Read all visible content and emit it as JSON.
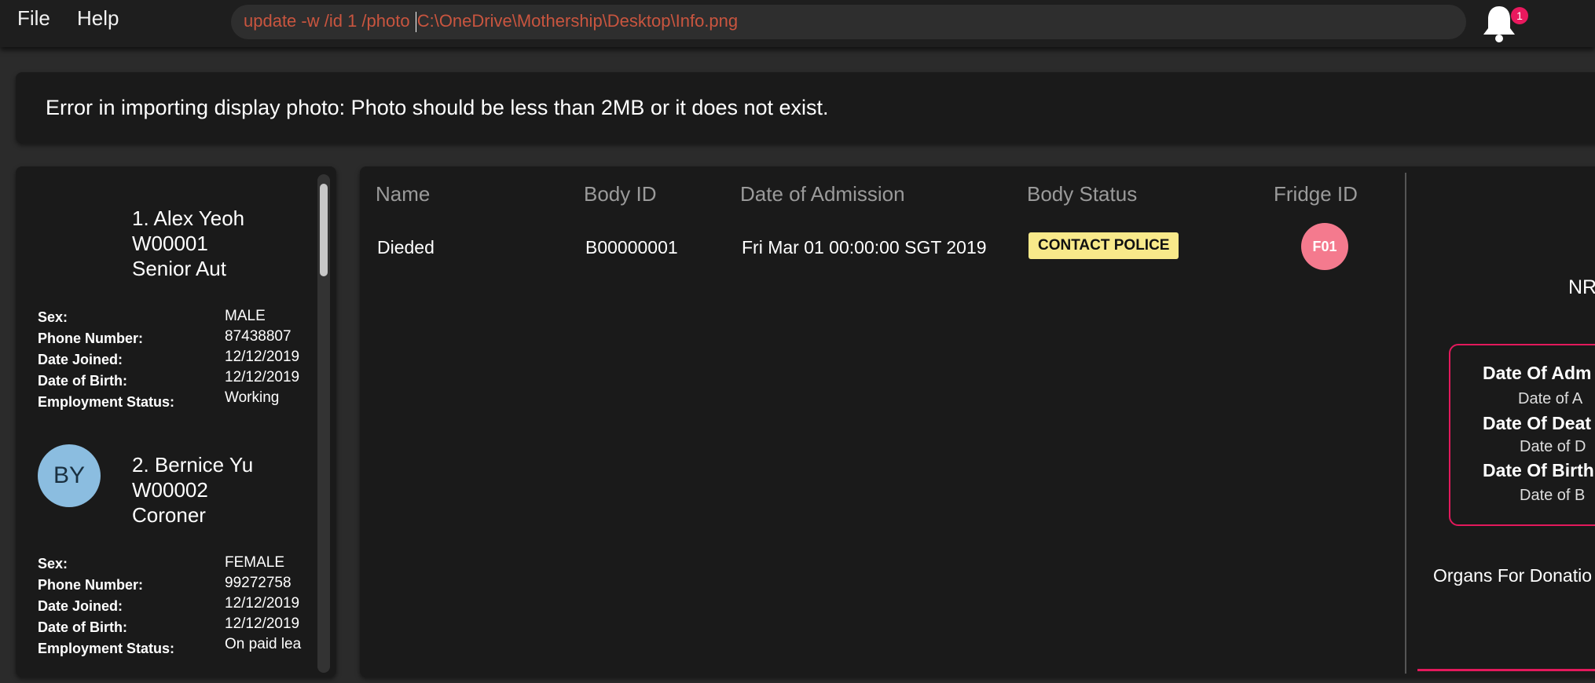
{
  "menu": {
    "file": "File",
    "help": "Help"
  },
  "command": {
    "before_cursor": "update -w /id 1 /photo ",
    "after_cursor": "C:\\OneDrive\\Mothership\\Desktop\\Info.png"
  },
  "notifications": {
    "count": "1"
  },
  "result": {
    "message": "Error in importing display photo: Photo should be less than 2MB or it does not exist."
  },
  "workers": [
    {
      "index_name": "1. Alex Yeoh",
      "id": "W00001",
      "designation": "Senior Aut",
      "initials": "",
      "sex_label": "Sex:",
      "sex": "MALE",
      "phone_label": "Phone Number:",
      "phone": "87438807",
      "joined_label": "Date Joined:",
      "joined": "12/12/2019",
      "dob_label": "Date of Birth:",
      "dob": "12/12/2019",
      "employment_label": "Employment Status:",
      "employment": "Working"
    },
    {
      "index_name": "2. Bernice Yu",
      "id": "W00002",
      "designation": "Coroner",
      "initials": "BY",
      "sex_label": "Sex:",
      "sex": "FEMALE",
      "phone_label": "Phone Number:",
      "phone": "99272758",
      "joined_label": "Date Joined:",
      "joined": "12/12/2019",
      "dob_label": "Date of Birth:",
      "dob": "12/12/2019",
      "employment_label": "Employment Status:",
      "employment": "On paid lea"
    }
  ],
  "bodies_table": {
    "headers": {
      "name": "Name",
      "body_id": "Body ID",
      "admission": "Date of Admission",
      "status": "Body Status",
      "fridge": "Fridge ID"
    },
    "rows": [
      {
        "name": "Dieded",
        "body_id": "B00000001",
        "admission": "Fri Mar 01 00:00:00 SGT 2019",
        "status": "CONTACT POLICE",
        "fridge": "F01"
      }
    ]
  },
  "details": {
    "nr_label": "NR",
    "admission_key": "Date Of Adm",
    "admission_val": "Date of A",
    "death_key": "Date Of Deat",
    "death_val": "Date of D",
    "birth_key": "Date Of Birth",
    "birth_val": "Date of B",
    "organs_label": "Organs For Donatio"
  },
  "colors": {
    "accent": "#e3195c",
    "command_text": "#c9553f",
    "status_badge": "#f8e98a",
    "fridge_badge": "#f47a8e",
    "avatar": "#8bbde0"
  },
  "icons": {
    "notifications": "bell-icon"
  }
}
